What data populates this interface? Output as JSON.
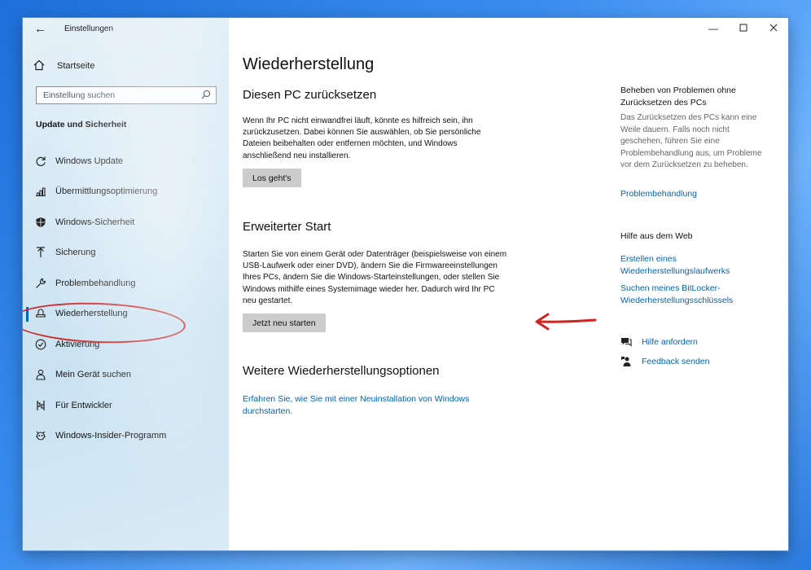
{
  "window": {
    "app_title": "Einstellungen"
  },
  "sidebar": {
    "home_label": "Startseite",
    "search_placeholder": "Einstellung suchen",
    "section_title": "Update und Sicherheit",
    "items": [
      {
        "label": "Windows Update",
        "icon": "refresh-icon"
      },
      {
        "label": "Übermittlungsoptimierung",
        "icon": "delivery-optimization-icon"
      },
      {
        "label": "Windows-Sicherheit",
        "icon": "shield-icon"
      },
      {
        "label": "Sicherung",
        "icon": "backup-arrow-icon"
      },
      {
        "label": "Problembehandlung",
        "icon": "wrench-icon"
      },
      {
        "label": "Wiederherstellung",
        "icon": "recovery-icon",
        "active": true
      },
      {
        "label": "Aktivierung",
        "icon": "check-circle-icon"
      },
      {
        "label": "Mein Gerät suchen",
        "icon": "person-pin-icon"
      },
      {
        "label": "Für Entwickler",
        "icon": "developer-icon"
      },
      {
        "label": "Windows-Insider-Programm",
        "icon": "insider-icon"
      }
    ]
  },
  "main": {
    "page_title": "Wiederherstellung",
    "reset": {
      "heading": "Diesen PC zurücksetzen",
      "text": "Wenn Ihr PC nicht einwandfrei läuft, könnte es hilfreich sein, ihn zurückzusetzen. Dabei können Sie auswählen, ob Sie persönliche Dateien beibehalten oder entfernen möchten, und Windows anschließend neu installieren.",
      "button": "Los geht's"
    },
    "advanced": {
      "heading": "Erweiterter Start",
      "text": "Starten Sie von einem Gerät oder Datenträger (beispielsweise von einem USB-Laufwerk oder einer DVD), ändern Sie die Firmwareeinstellungen Ihres PCs, ändern Sie die Windows-Starteinstellungen, oder stellen Sie Windows mithilfe eines Systemimage wieder her. Dadurch wird Ihr PC neu gestartet.",
      "button": "Jetzt neu starten"
    },
    "more": {
      "heading": "Weitere Wiederherstellungsoptionen",
      "link": "Erfahren Sie, wie Sie mit einer Neuinstallation von Windows durchstarten."
    }
  },
  "right": {
    "troubleshoot_heading": "Beheben von Problemen ohne Zurücksetzen des PCs",
    "troubleshoot_text": "Das Zurücksetzen des PCs kann eine Weile dauern. Falls noch nicht geschehen, führen Sie eine Problembehandlung aus, um Probleme vor dem Zurücksetzen zu beheben.",
    "troubleshoot_link": "Problembehandlung",
    "web_heading": "Hilfe aus dem Web",
    "web_link1": "Erstellen eines Wiederherstellungslaufwerks",
    "web_link2": "Suchen meines BitLocker-Wiederherstellungsschlüssels",
    "help_label": "Hilfe anfordern",
    "feedback_label": "Feedback senden"
  },
  "colors": {
    "accent": "#0064b4",
    "annotation": "#d12525"
  }
}
